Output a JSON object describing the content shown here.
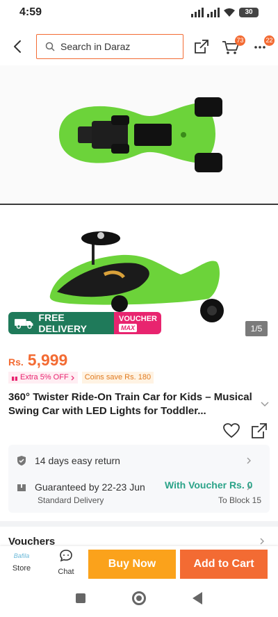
{
  "status": {
    "time": "4:59",
    "battery": "30"
  },
  "header": {
    "search_placeholder": "Search in Daraz",
    "cart_count": "73",
    "more_count": "22"
  },
  "gallery": {
    "free_delivery_label": "FREE DELIVERY",
    "voucher_label": "VOUCHER",
    "voucher_max_label": "MAX",
    "page_indicator": "1/5"
  },
  "product": {
    "currency": "Rs.",
    "price": "5,999",
    "extra_off_label": "Extra 5% OFF",
    "coins_label": "Coins save Rs. 180",
    "title": "360° Twister Ride-On Train Car for Kids – Musical Swing Car with LED Lights for Toddler..."
  },
  "info": {
    "return_label": "14 days easy return",
    "guarantee_label": "Guaranteed by 22-23 Jun",
    "voucher_text": "With Voucher Rs. 0",
    "delivery_type": "Standard Delivery",
    "destination": "To Block 15"
  },
  "sections": {
    "vouchers_title": "Vouchers"
  },
  "action_bar": {
    "store_label": "Store",
    "store_logo_text": "Bafila",
    "chat_label": "Chat",
    "buy_now_label": "Buy Now",
    "add_to_cart_label": "Add to Cart"
  },
  "colors": {
    "brand_orange": "#f36b33",
    "buy_now_yellow": "#fba21b",
    "delivery_green": "#1f7a5a",
    "voucher_pink": "#e8246f",
    "voucher_text_green": "#2aa388",
    "product_green": "#6cd33a"
  }
}
